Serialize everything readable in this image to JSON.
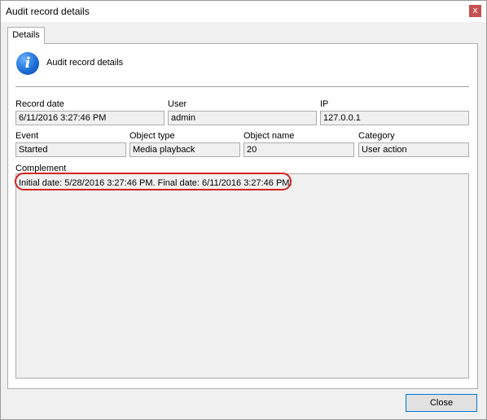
{
  "window": {
    "title": "Audit record details",
    "close_glyph": "x"
  },
  "tabs": [
    {
      "label": "Details"
    }
  ],
  "header": {
    "icon": "info-icon",
    "title": "Audit record details"
  },
  "fields": {
    "record_date": {
      "label": "Record date",
      "value": "6/11/2016 3:27:46 PM"
    },
    "user": {
      "label": "User",
      "value": "admin"
    },
    "ip": {
      "label": "IP",
      "value": "127.0.0.1"
    },
    "event": {
      "label": "Event",
      "value": "Started"
    },
    "object_type": {
      "label": "Object type",
      "value": "Media playback"
    },
    "object_name": {
      "label": "Object name",
      "value": "20"
    },
    "category": {
      "label": "Category",
      "value": "User action"
    }
  },
  "complement": {
    "label": "Complement",
    "value": "Initial date: 5/28/2016 3:27:46 PM. Final date: 6/11/2016 3:27:46 PM."
  },
  "buttons": {
    "close": "Close"
  },
  "colors": {
    "annotation": "#d42020",
    "focus_border": "#0078d7"
  }
}
